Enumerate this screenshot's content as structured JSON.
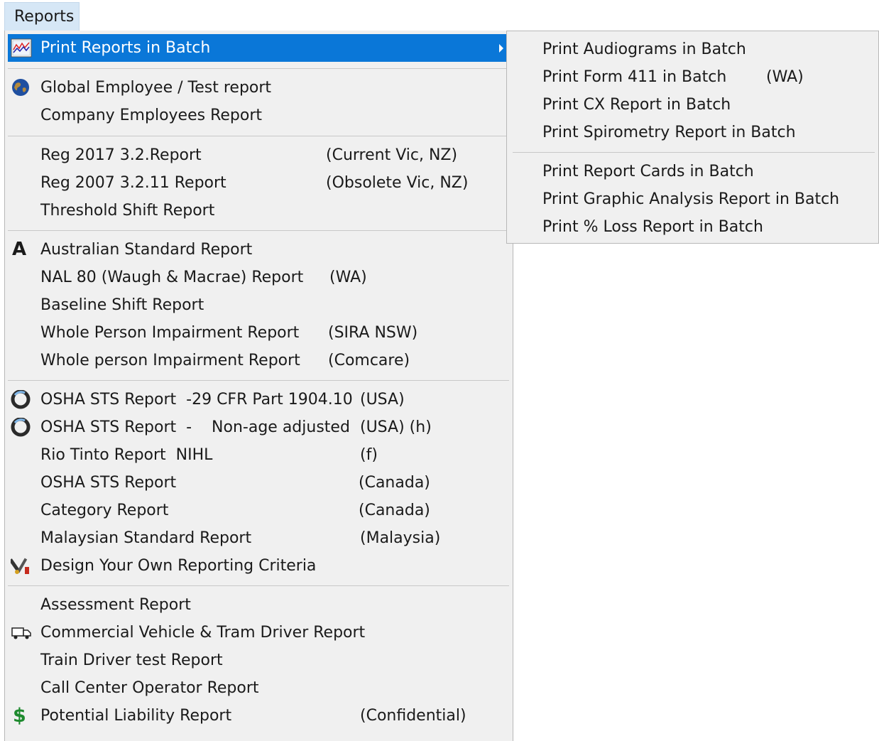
{
  "menubar": {
    "reports_label": "Reports"
  },
  "menu": {
    "print_batch": {
      "label": "Print Reports in Batch",
      "icon": "chart-icon"
    },
    "global_employee": {
      "label": "Global Employee / Test report",
      "icon": "globe-icon"
    },
    "company_employees": {
      "label": "Company Employees Report"
    },
    "reg2017": {
      "label": "Reg 2017 3.2.Report",
      "extra": "(Current Vic, NZ)"
    },
    "reg2007": {
      "label": "Reg 2007 3.2.11 Report",
      "extra": "(Obsolete Vic, NZ)"
    },
    "threshold": {
      "label": "Threshold Shift Report"
    },
    "australian": {
      "label": "Australian Standard Report",
      "icon": "letter-a-icon",
      "icon_text": "A"
    },
    "nal80": {
      "label": "NAL 80 (Waugh & Macrae) Report",
      "extra": "(WA)"
    },
    "baseline": {
      "label": "Baseline Shift Report"
    },
    "wpi_sira": {
      "label": "Whole Person Impairment Report",
      "extra": "(SIRA NSW)"
    },
    "wpi_comcare": {
      "label": "Whole person Impairment Report",
      "extra": "(Comcare)"
    },
    "osha_29cfr": {
      "label": "OSHA STS Report  -29 CFR Part 1904.10",
      "extra": "(USA)",
      "icon": "osha-ring-icon"
    },
    "osha_nonage": {
      "label": "OSHA STS Report  -    Non-age adjusted",
      "extra": "(USA) (h)",
      "icon": "osha-ring-icon"
    },
    "rio_tinto": {
      "label": "Rio Tinto Report  NIHL",
      "extra": "(f)"
    },
    "osha_canada": {
      "label": "OSHA STS Report",
      "extra": "(Canada)"
    },
    "category": {
      "label": "Category Report",
      "extra": "(Canada)"
    },
    "malaysian": {
      "label": "Malaysian Standard Report",
      "extra": "(Malaysia)"
    },
    "design_own": {
      "label": "Design Your Own Reporting Criteria",
      "icon": "tools-icon"
    },
    "assessment": {
      "label": "Assessment Report"
    },
    "commercial_vehicle": {
      "label": "Commercial Vehicle & Tram Driver Report",
      "icon": "truck-icon"
    },
    "train_driver": {
      "label": "Train Driver test Report"
    },
    "call_center": {
      "label": "Call Center Operator Report"
    },
    "liability": {
      "label": "Potential Liability Report",
      "extra": "(Confidential)",
      "icon": "dollar-icon",
      "icon_text": "$"
    }
  },
  "submenu": {
    "audiograms": {
      "label": "Print Audiograms in Batch"
    },
    "form411": {
      "label": "Print Form 411 in Batch",
      "extra": "(WA)"
    },
    "cx": {
      "label": "Print CX Report in Batch"
    },
    "spirometry": {
      "label": "Print Spirometry Report in Batch"
    },
    "report_cards": {
      "label": "Print Report Cards in Batch"
    },
    "graphic_analysis": {
      "label": "Print Graphic Analysis Report in Batch"
    },
    "loss": {
      "label": "Print % Loss Report in Batch"
    }
  },
  "colors": {
    "highlight": "#0a77d8",
    "menu_bg": "#f0f0f0",
    "menubar_active": "#d6e7f6"
  }
}
